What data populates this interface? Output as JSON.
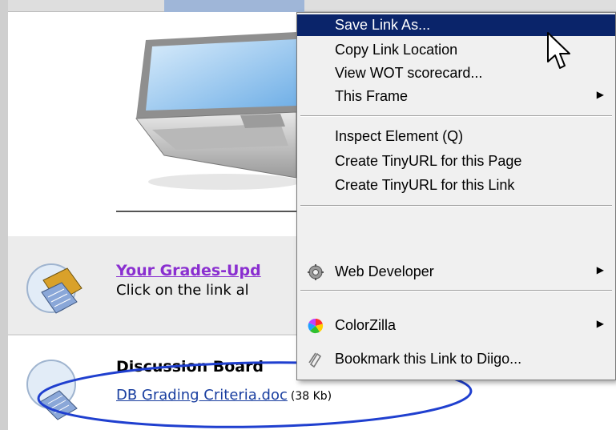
{
  "page": {
    "grades_link": "Your Grades-Upd",
    "grades_desc": "Click on the link al",
    "db_title": "Discussion Board",
    "db_link": "DB Grading Criteria.doc",
    "db_size": "(38 Kb)"
  },
  "menu": {
    "items": [
      {
        "label": "Save Link As...",
        "selected": true
      },
      {
        "label": "Copy Link Location"
      },
      {
        "label": "View WOT scorecard..."
      },
      {
        "label": "This Frame",
        "submenu": true
      },
      {
        "label": "Inspect Element (Q)"
      },
      {
        "label": "Create TinyURL for this Page"
      },
      {
        "label": "Create TinyURL for this Link"
      },
      {
        "label": "Web Developer",
        "submenu": true,
        "icon": "gear-icon"
      },
      {
        "label": "ColorZilla",
        "submenu": true,
        "icon": "color-wheel-icon"
      },
      {
        "label": "Bookmark this Link to Diigo...",
        "icon": "diigo-icon"
      }
    ],
    "submenu_arrow": "▶"
  },
  "colors": {
    "menu_highlight": "#0a246a",
    "visited_link": "#8a2fd0",
    "link": "#1a3fa0",
    "annotation": "#1f3fcf"
  }
}
